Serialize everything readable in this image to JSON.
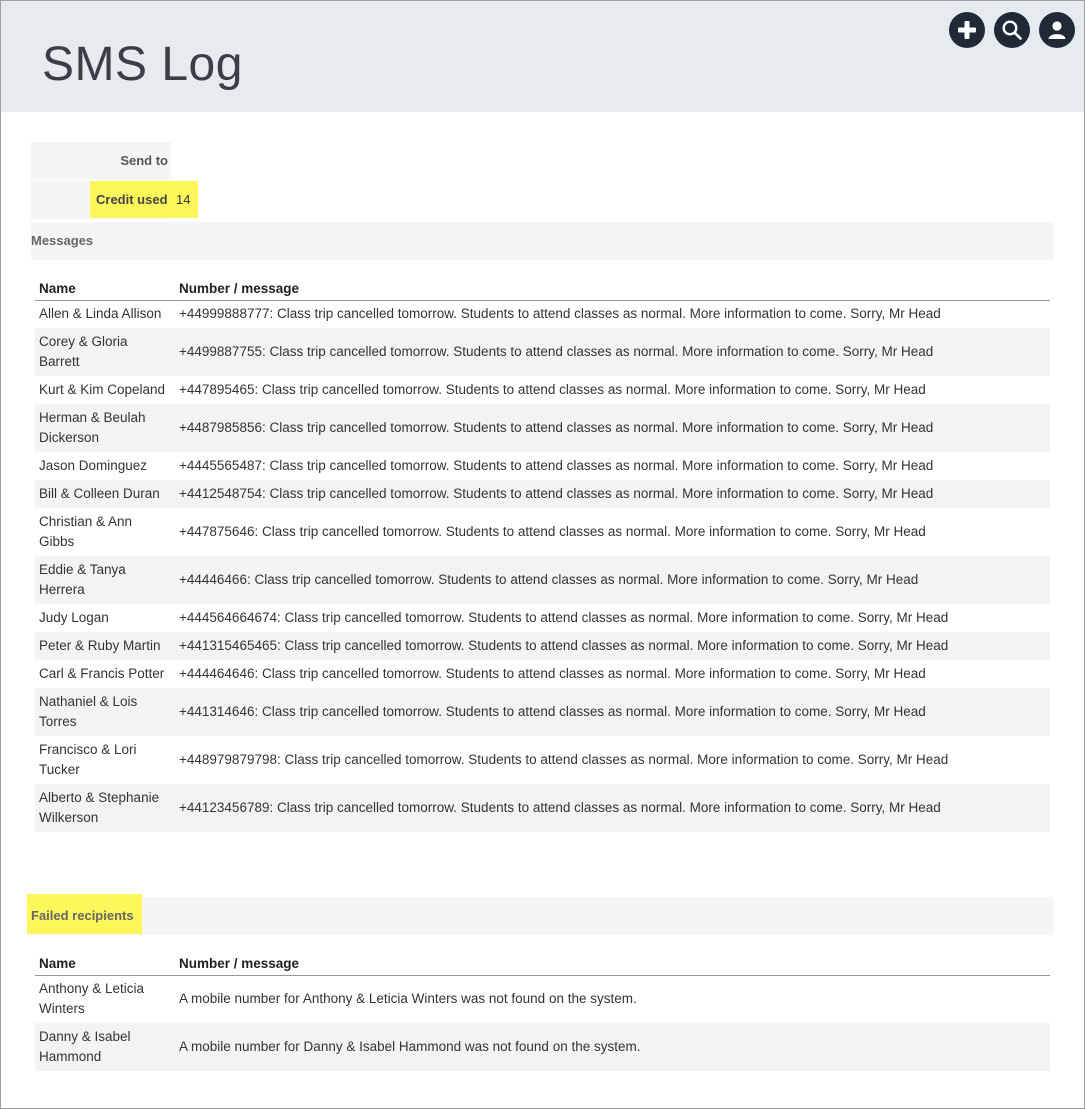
{
  "header": {
    "title": "SMS Log",
    "icons": [
      "plus-icon",
      "search-icon",
      "user-icon"
    ]
  },
  "meta": {
    "send_to_label": "Send to",
    "send_to_value": "",
    "credit_used_label": "Credit used",
    "credit_used_value": "14"
  },
  "messages": {
    "title": "Messages",
    "columns": [
      "Name",
      "Number / message"
    ],
    "rows": [
      {
        "name": "Allen & Linda Allison",
        "message": "+44999888777: Class trip cancelled tomorrow. Students to attend classes as normal. More information to come. Sorry, Mr Head"
      },
      {
        "name": "Corey & Gloria Barrett",
        "message": "+4499887755: Class trip cancelled tomorrow. Students to attend classes as normal. More information to come. Sorry, Mr Head"
      },
      {
        "name": "Kurt & Kim Copeland",
        "message": "+447895465: Class trip cancelled tomorrow. Students to attend classes as normal. More information to come. Sorry, Mr Head"
      },
      {
        "name": "Herman & Beulah Dickerson",
        "message": "+4487985856: Class trip cancelled tomorrow. Students to attend classes as normal. More information to come. Sorry, Mr Head"
      },
      {
        "name": "Jason Dominguez",
        "message": "+4445565487: Class trip cancelled tomorrow. Students to attend classes as normal. More information to come. Sorry, Mr Head"
      },
      {
        "name": "Bill & Colleen Duran",
        "message": "+4412548754: Class trip cancelled tomorrow. Students to attend classes as normal. More information to come. Sorry, Mr Head"
      },
      {
        "name": "Christian & Ann Gibbs",
        "message": "+447875646: Class trip cancelled tomorrow. Students to attend classes as normal. More information to come. Sorry, Mr Head"
      },
      {
        "name": "Eddie & Tanya Herrera",
        "message": "+44446466: Class trip cancelled tomorrow. Students to attend classes as normal. More information to come. Sorry, Mr Head"
      },
      {
        "name": "Judy Logan",
        "message": "+444564664674: Class trip cancelled tomorrow. Students to attend classes as normal. More information to come. Sorry, Mr Head"
      },
      {
        "name": "Peter & Ruby Martin",
        "message": "+441315465465: Class trip cancelled tomorrow. Students to attend classes as normal. More information to come. Sorry, Mr Head"
      },
      {
        "name": "Carl & Francis Potter",
        "message": "+444464646: Class trip cancelled tomorrow. Students to attend classes as normal. More information to come. Sorry, Mr Head"
      },
      {
        "name": "Nathaniel & Lois Torres",
        "message": "+441314646: Class trip cancelled tomorrow. Students to attend classes as normal. More information to come. Sorry, Mr Head"
      },
      {
        "name": "Francisco & Lori Tucker",
        "message": "+448979879798: Class trip cancelled tomorrow. Students to attend classes as normal. More information to come. Sorry, Mr Head"
      },
      {
        "name": "Alberto & Stephanie Wilkerson",
        "message": "+44123456789: Class trip cancelled tomorrow. Students to attend classes as normal. More information to come. Sorry, Mr Head"
      }
    ]
  },
  "failed": {
    "title": "Failed recipients",
    "columns": [
      "Name",
      "Number / message"
    ],
    "rows": [
      {
        "name": "Anthony & Leticia Winters",
        "message": "A mobile number for Anthony & Leticia Winters was not found on the system."
      },
      {
        "name": "Danny & Isabel Hammond",
        "message": "A mobile number for Danny & Isabel Hammond was not found on the system."
      }
    ]
  },
  "colors": {
    "highlight": "#fbf65a",
    "header_bg": "#e6ebf0",
    "icon_bg": "#1f2a36"
  }
}
